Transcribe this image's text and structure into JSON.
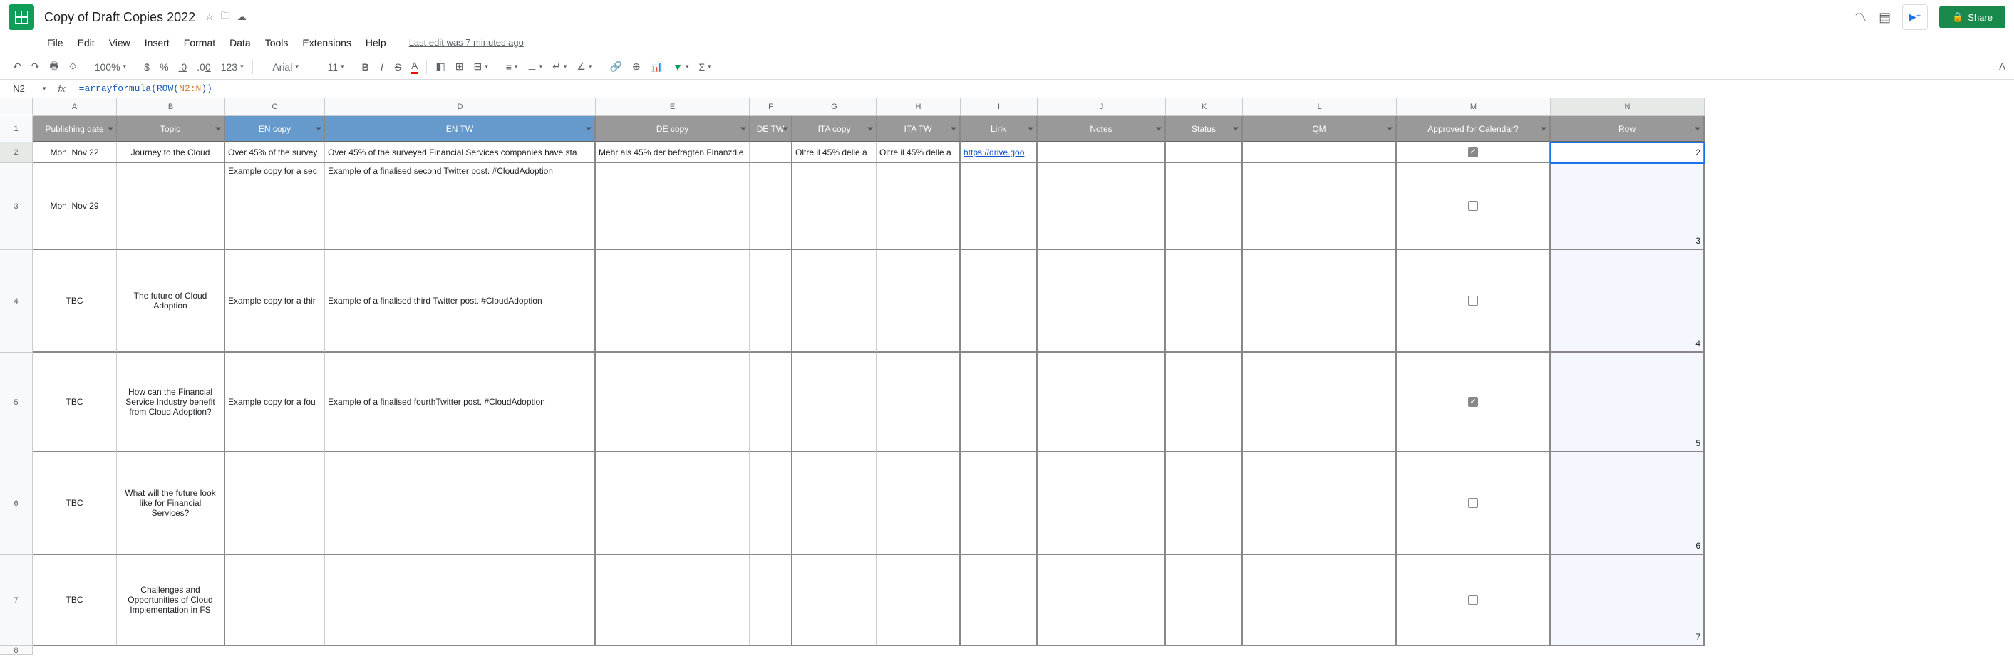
{
  "doc": {
    "title": "Copy of Draft Copies 2022",
    "last_edit": "Last edit was 7 minutes ago"
  },
  "menu": {
    "file": "File",
    "edit": "Edit",
    "view": "View",
    "insert": "Insert",
    "format": "Format",
    "data": "Data",
    "tools": "Tools",
    "extensions": "Extensions",
    "help": "Help"
  },
  "toolbar": {
    "zoom": "100%",
    "font": "Arial",
    "size": "11",
    "currency": "$",
    "percent": "%",
    "dec_dec": ".0",
    "dec_inc": ".00",
    "num_fmt": "123"
  },
  "share": {
    "label": "Share"
  },
  "formula": {
    "cell_ref": "N2",
    "prefix": "=arrayformula(ROW(",
    "ref": "N2:N",
    "suffix": "))"
  },
  "columns": [
    "A",
    "B",
    "C",
    "D",
    "E",
    "F",
    "G",
    "H",
    "I",
    "J",
    "K",
    "L",
    "M",
    "N"
  ],
  "headers": {
    "A": "Publishing date",
    "B": "Topic",
    "C": "EN copy",
    "D": "EN TW",
    "E": "DE copy",
    "F": "DE TW",
    "G": "ITA copy",
    "H": "ITA TW",
    "I": "Link",
    "J": "Notes",
    "K": "Status",
    "L": "QM",
    "M": "Approved for Calendar?",
    "N": "Row"
  },
  "row_labels": [
    "1",
    "2",
    "3",
    "4",
    "5",
    "6",
    "7",
    "8"
  ],
  "rows": [
    {
      "A": "Mon, Nov 22",
      "B": "Journey to the Cloud",
      "C": "Over 45% of the survey",
      "D": "Over 45% of the surveyed Financial Services companies have sta",
      "E": "Mehr als 45% der befragten Finanzdie",
      "F": "",
      "G": "Oltre il 45% delle a",
      "H": "Oltre il 45% delle a",
      "I": "https://drive.goo",
      "J": "",
      "K": "",
      "L": "",
      "M_checked": true,
      "N": "2"
    },
    {
      "A": "Mon, Nov 29",
      "B": "",
      "C": "Example copy for a sec",
      "D": "Example of a finalised second Twitter post. #CloudAdoption",
      "E": "",
      "F": "",
      "G": "",
      "H": "",
      "I": "",
      "J": "",
      "K": "",
      "L": "",
      "M_checked": false,
      "N": "3"
    },
    {
      "A": "TBC",
      "B": "The future of Cloud Adoption",
      "C": "Example copy for a thir",
      "D": "Example of a finalised third Twitter post. #CloudAdoption",
      "E": "",
      "F": "",
      "G": "",
      "H": "",
      "I": "",
      "J": "",
      "K": "",
      "L": "",
      "M_checked": false,
      "N": "4"
    },
    {
      "A": "TBC",
      "B": "How can the Financial Service Industry benefit from Cloud Adoption?",
      "C": "Example copy for a fou",
      "D": "Example of a finalised fourthTwitter post. #CloudAdoption",
      "E": "",
      "F": "",
      "G": "",
      "H": "",
      "I": "",
      "J": "",
      "K": "",
      "L": "",
      "M_checked": true,
      "N": "5"
    },
    {
      "A": "TBC",
      "B": "What will the future look like for Financial Services?",
      "C": "",
      "D": "",
      "E": "",
      "F": "",
      "G": "",
      "H": "",
      "I": "",
      "J": "",
      "K": "",
      "L": "",
      "M_checked": false,
      "N": "6"
    },
    {
      "A": "TBC",
      "B": "Challenges and Opportunities of Cloud Implementation in FS",
      "C": "",
      "D": "",
      "E": "",
      "F": "",
      "G": "",
      "H": "",
      "I": "",
      "J": "",
      "K": "",
      "L": "",
      "M_checked": false,
      "N": "7"
    }
  ]
}
